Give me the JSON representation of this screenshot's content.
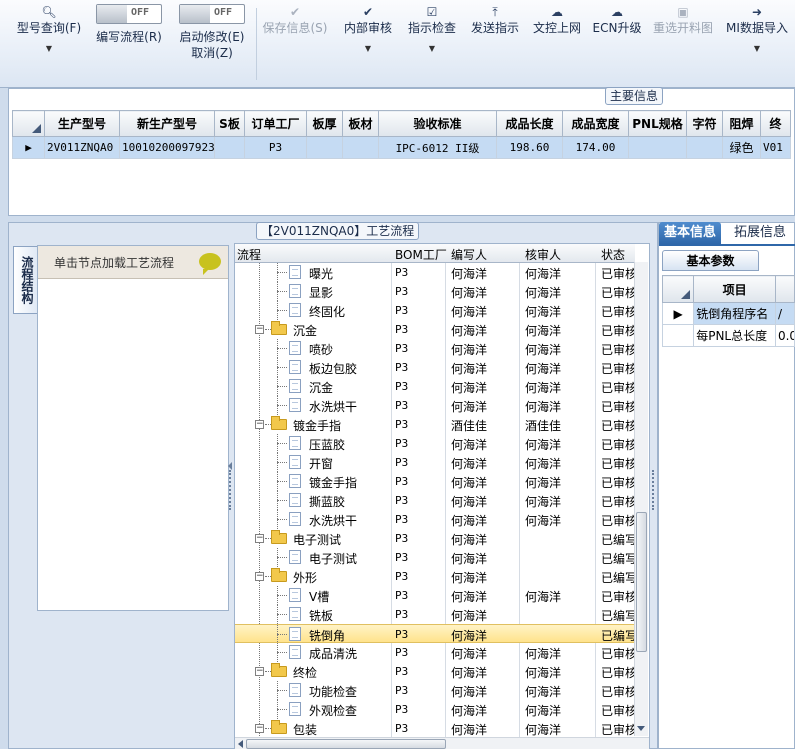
{
  "toolbar": {
    "model_query": {
      "label": "型号查询(F)",
      "icon": "search-icon"
    },
    "edit_flow": {
      "label": "编写流程(R)",
      "toggle": "OFF"
    },
    "auto_modify": {
      "label": "启动修改(E)",
      "label2": "取消(Z)",
      "toggle": "OFF"
    },
    "save_info": {
      "label": "保存信息(S)",
      "icon": "check-icon"
    },
    "internal_review": {
      "label": "内部审核",
      "icon": "check-icon"
    },
    "instruction_check": {
      "label": "指示检查",
      "icon": "checkbox-icon"
    },
    "send_instruction": {
      "label": "发送指示",
      "icon": "upload-icon"
    },
    "doc_upload": {
      "label": "文控上网",
      "icon": "cloud-upload-icon"
    },
    "ecn_upgrade": {
      "label": "ECN升级",
      "icon": "cloud-icon"
    },
    "reissue_chart": {
      "label": "重选开料图",
      "icon": "image-icon"
    },
    "mi_import": {
      "label": "MI数据导入",
      "icon": "import-icon"
    }
  },
  "main_info": {
    "caption": "主要信息",
    "columns": [
      "生产型号",
      "新生产型号",
      "S板",
      "订单工厂",
      "板厚",
      "板材",
      "验收标准",
      "成品长度",
      "成品宽度",
      "PNL规格",
      "字符",
      "阻焊",
      "终"
    ],
    "rows": [
      [
        "2V011ZNQA0",
        "10010200097923",
        "",
        "P3",
        "",
        "",
        "IPC-6012 II级",
        "198.60",
        "174.00",
        "",
        "",
        "绿色",
        "V01"
      ]
    ]
  },
  "process": {
    "caption": "【2V011ZNQA0】工艺流程",
    "side_tab": "流程结构",
    "hint": "单击节点加载工艺流程",
    "columns": [
      "流程",
      "BOM工厂",
      "编写人",
      "核审人",
      "状态"
    ],
    "rows": [
      {
        "name": "曝光",
        "level": 2,
        "type": "doc",
        "factory": "P3",
        "writer": "何海洋",
        "reviewer": "何海洋",
        "status": "已审核"
      },
      {
        "name": "显影",
        "level": 2,
        "type": "doc",
        "factory": "P3",
        "writer": "何海洋",
        "reviewer": "何海洋",
        "status": "已审核"
      },
      {
        "name": "终固化",
        "level": 2,
        "type": "doc",
        "factory": "P3",
        "writer": "何海洋",
        "reviewer": "何海洋",
        "status": "已审核"
      },
      {
        "name": "沉金",
        "level": 1,
        "type": "folder",
        "factory": "P3",
        "writer": "何海洋",
        "reviewer": "何海洋",
        "status": "已审核"
      },
      {
        "name": "喷砂",
        "level": 2,
        "type": "doc",
        "factory": "P3",
        "writer": "何海洋",
        "reviewer": "何海洋",
        "status": "已审核"
      },
      {
        "name": "板边包胶",
        "level": 2,
        "type": "doc",
        "factory": "P3",
        "writer": "何海洋",
        "reviewer": "何海洋",
        "status": "已审核"
      },
      {
        "name": "沉金",
        "level": 2,
        "type": "doc",
        "factory": "P3",
        "writer": "何海洋",
        "reviewer": "何海洋",
        "status": "已审核"
      },
      {
        "name": "水洗烘干",
        "level": 2,
        "type": "doc",
        "factory": "P3",
        "writer": "何海洋",
        "reviewer": "何海洋",
        "status": "已审核"
      },
      {
        "name": "镀金手指",
        "level": 1,
        "type": "folder",
        "factory": "P3",
        "writer": "酒佳佳",
        "reviewer": "酒佳佳",
        "status": "已审核"
      },
      {
        "name": "压蓝胶",
        "level": 2,
        "type": "doc",
        "factory": "P3",
        "writer": "何海洋",
        "reviewer": "何海洋",
        "status": "已审核"
      },
      {
        "name": "开窗",
        "level": 2,
        "type": "doc",
        "factory": "P3",
        "writer": "何海洋",
        "reviewer": "何海洋",
        "status": "已审核"
      },
      {
        "name": "镀金手指",
        "level": 2,
        "type": "doc",
        "factory": "P3",
        "writer": "何海洋",
        "reviewer": "何海洋",
        "status": "已审核"
      },
      {
        "name": "撕蓝胶",
        "level": 2,
        "type": "doc",
        "factory": "P3",
        "writer": "何海洋",
        "reviewer": "何海洋",
        "status": "已审核"
      },
      {
        "name": "水洗烘干",
        "level": 2,
        "type": "doc",
        "factory": "P3",
        "writer": "何海洋",
        "reviewer": "何海洋",
        "status": "已审核"
      },
      {
        "name": "电子测试",
        "level": 1,
        "type": "folder",
        "factory": "P3",
        "writer": "何海洋",
        "reviewer": "",
        "status": "已编写"
      },
      {
        "name": "电子测试",
        "level": 2,
        "type": "doc",
        "factory": "P3",
        "writer": "何海洋",
        "reviewer": "",
        "status": "已编写"
      },
      {
        "name": "外形",
        "level": 1,
        "type": "folder",
        "factory": "P3",
        "writer": "何海洋",
        "reviewer": "",
        "status": "已编写"
      },
      {
        "name": "V槽",
        "level": 2,
        "type": "doc",
        "factory": "P3",
        "writer": "何海洋",
        "reviewer": "何海洋",
        "status": "已审核"
      },
      {
        "name": "铣板",
        "level": 2,
        "type": "doc",
        "factory": "P3",
        "writer": "何海洋",
        "reviewer": "",
        "status": "已编写"
      },
      {
        "name": "铣倒角",
        "level": 2,
        "type": "doc",
        "factory": "P3",
        "writer": "何海洋",
        "reviewer": "",
        "status": "已编写",
        "selected": true
      },
      {
        "name": "成品清洗",
        "level": 2,
        "type": "doc",
        "factory": "P3",
        "writer": "何海洋",
        "reviewer": "何海洋",
        "status": "已审核"
      },
      {
        "name": "终检",
        "level": 1,
        "type": "folder",
        "factory": "P3",
        "writer": "何海洋",
        "reviewer": "何海洋",
        "status": "已审核"
      },
      {
        "name": "功能检查",
        "level": 2,
        "type": "doc",
        "factory": "P3",
        "writer": "何海洋",
        "reviewer": "何海洋",
        "status": "已审核"
      },
      {
        "name": "外观检查",
        "level": 2,
        "type": "doc",
        "factory": "P3",
        "writer": "何海洋",
        "reviewer": "何海洋",
        "status": "已审核"
      },
      {
        "name": "包装",
        "level": 1,
        "type": "folder",
        "factory": "P3",
        "writer": "何海洋",
        "reviewer": "何海洋",
        "status": "已审核"
      }
    ]
  },
  "right_panel": {
    "tabs": [
      "基本信息",
      "拓展信息"
    ],
    "sub_tab": "基本参数",
    "column": "项目",
    "rows": [
      {
        "item": "铣倒角程序名",
        "value": "/"
      },
      {
        "item": "每PNL总长度",
        "value": "0.0"
      }
    ]
  },
  "colors": {
    "accent": "#2f67a9",
    "selection": "#c5dbf3",
    "highlight": "#ffe38c"
  }
}
